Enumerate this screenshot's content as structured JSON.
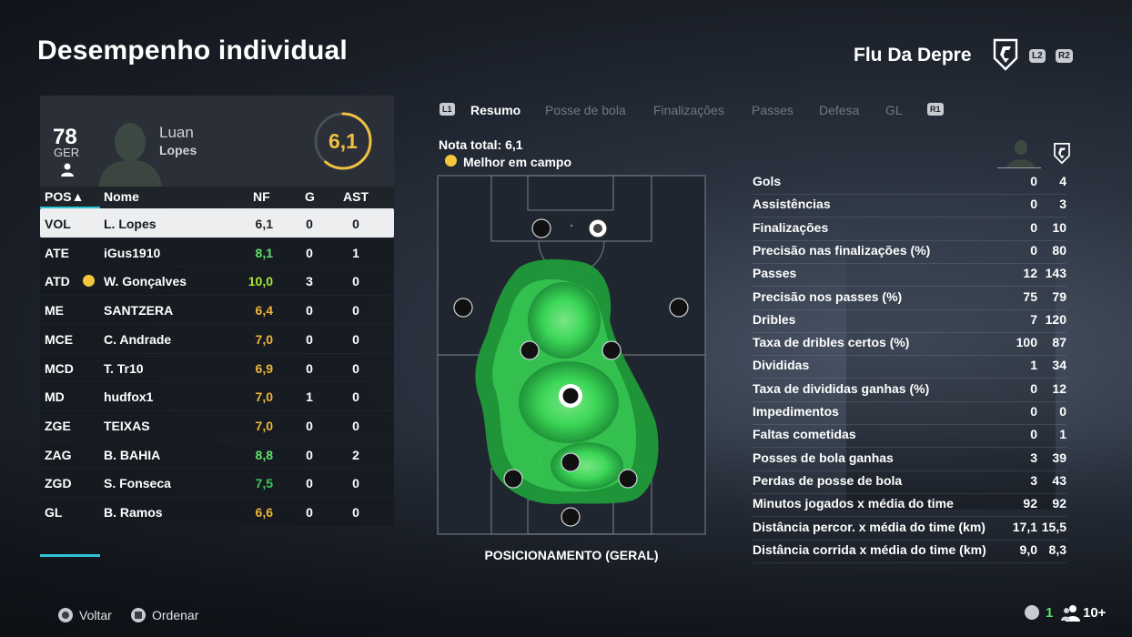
{
  "page": {
    "title": "Desempenho individual"
  },
  "team": {
    "name": "Flu Da Depre",
    "button_left": "L2",
    "button_right": "R2",
    "badge_icon": "club-crest-icon"
  },
  "player": {
    "overall": "78",
    "position": "GER",
    "first_name": "Luan",
    "last_name": "Lopes",
    "match_rating": "6,1"
  },
  "table": {
    "headers": {
      "pos": "POS▲",
      "name": "Nome",
      "nf": "NF",
      "g": "G",
      "ast": "AST"
    },
    "rows": [
      {
        "pos": "VOL",
        "name": "L. Lopes",
        "nf": "6,1",
        "g": "0",
        "ast": "0",
        "nf_color": "#222222",
        "selected": true,
        "motm": false
      },
      {
        "pos": "ATE",
        "name": "iGus1910",
        "nf": "8,1",
        "g": "0",
        "ast": "1",
        "nf_color": "#5fe06a",
        "selected": false,
        "motm": false
      },
      {
        "pos": "ATD",
        "name": "W. Gonçalves",
        "nf": "10,0",
        "g": "3",
        "ast": "0",
        "nf_color": "#a8e83a",
        "selected": false,
        "motm": true
      },
      {
        "pos": "ME",
        "name": "SANTZERA",
        "nf": "6,4",
        "g": "0",
        "ast": "0",
        "nf_color": "#f0b43a",
        "selected": false,
        "motm": false
      },
      {
        "pos": "MCE",
        "name": "C. Andrade",
        "nf": "7,0",
        "g": "0",
        "ast": "0",
        "nf_color": "#f0b43a",
        "selected": false,
        "motm": false
      },
      {
        "pos": "MCD",
        "name": "T. Tr10",
        "nf": "6,9",
        "g": "0",
        "ast": "0",
        "nf_color": "#f0b43a",
        "selected": false,
        "motm": false
      },
      {
        "pos": "MD",
        "name": "hudfox1",
        "nf": "7,0",
        "g": "1",
        "ast": "0",
        "nf_color": "#f0b43a",
        "selected": false,
        "motm": false
      },
      {
        "pos": "ZGE",
        "name": "TEIXAS",
        "nf": "7,0",
        "g": "0",
        "ast": "0",
        "nf_color": "#f0b43a",
        "selected": false,
        "motm": false
      },
      {
        "pos": "ZAG",
        "name": "B. BAHIA",
        "nf": "8,8",
        "g": "0",
        "ast": "2",
        "nf_color": "#5fe06a",
        "selected": false,
        "motm": false
      },
      {
        "pos": "ZGD",
        "name": "S. Fonseca",
        "nf": "7,5",
        "g": "0",
        "ast": "0",
        "nf_color": "#3cc85a",
        "selected": false,
        "motm": false
      },
      {
        "pos": "GL",
        "name": "B. Ramos",
        "nf": "6,6",
        "g": "0",
        "ast": "0",
        "nf_color": "#f0b43a",
        "selected": false,
        "motm": false
      }
    ]
  },
  "tabs": {
    "left_button": "L1",
    "right_button": "R1",
    "items": [
      {
        "label": "Resumo",
        "active": true
      },
      {
        "label": "Posse de bola",
        "active": false
      },
      {
        "label": "Finalizações",
        "active": false
      },
      {
        "label": "Passes",
        "active": false
      },
      {
        "label": "Defesa",
        "active": false
      },
      {
        "label": "GL",
        "active": false
      }
    ]
  },
  "summary": {
    "nota_total": "Nota total: 6,1",
    "motm_label": "Melhor em campo",
    "pitch_caption": "POSICIONAMENTO (GERAL)"
  },
  "stats": [
    {
      "label": "Gols",
      "player": "0",
      "team": "4"
    },
    {
      "label": "Assistências",
      "player": "0",
      "team": "3"
    },
    {
      "label": "Finalizações",
      "player": "0",
      "team": "10"
    },
    {
      "label": "Precisão nas finalizações (%)",
      "player": "0",
      "team": "80"
    },
    {
      "label": "Passes",
      "player": "12",
      "team": "143"
    },
    {
      "label": "Precisão nos passes (%)",
      "player": "75",
      "team": "79"
    },
    {
      "label": "Dribles",
      "player": "7",
      "team": "120"
    },
    {
      "label": "Taxa de dribles certos (%)",
      "player": "100",
      "team": "87"
    },
    {
      "label": "Divididas",
      "player": "1",
      "team": "34"
    },
    {
      "label": "Taxa de divididas ganhas (%)",
      "player": "0",
      "team": "12"
    },
    {
      "label": "Impedimentos",
      "player": "0",
      "team": "0"
    },
    {
      "label": "Faltas cometidas",
      "player": "0",
      "team": "1"
    },
    {
      "label": "Posses de bola ganhas",
      "player": "3",
      "team": "39"
    },
    {
      "label": "Perdas de posse de bola",
      "player": "3",
      "team": "43"
    },
    {
      "label": "Minutos jogados x média do time",
      "player": "92",
      "team": "92"
    },
    {
      "label": "Distância percor. x média do time (km)",
      "player": "17,1",
      "team": "15,5"
    },
    {
      "label": "Distância corrida x média do time (km)",
      "player": "9,0",
      "team": "8,3"
    }
  ],
  "footer": {
    "back_label": "Voltar",
    "sort_label": "Ordenar",
    "count_green": "1",
    "count_players": "10+"
  },
  "colors": {
    "accent": "#2ec4d6",
    "heat": "#3ee05a",
    "gold": "#f0c040"
  }
}
